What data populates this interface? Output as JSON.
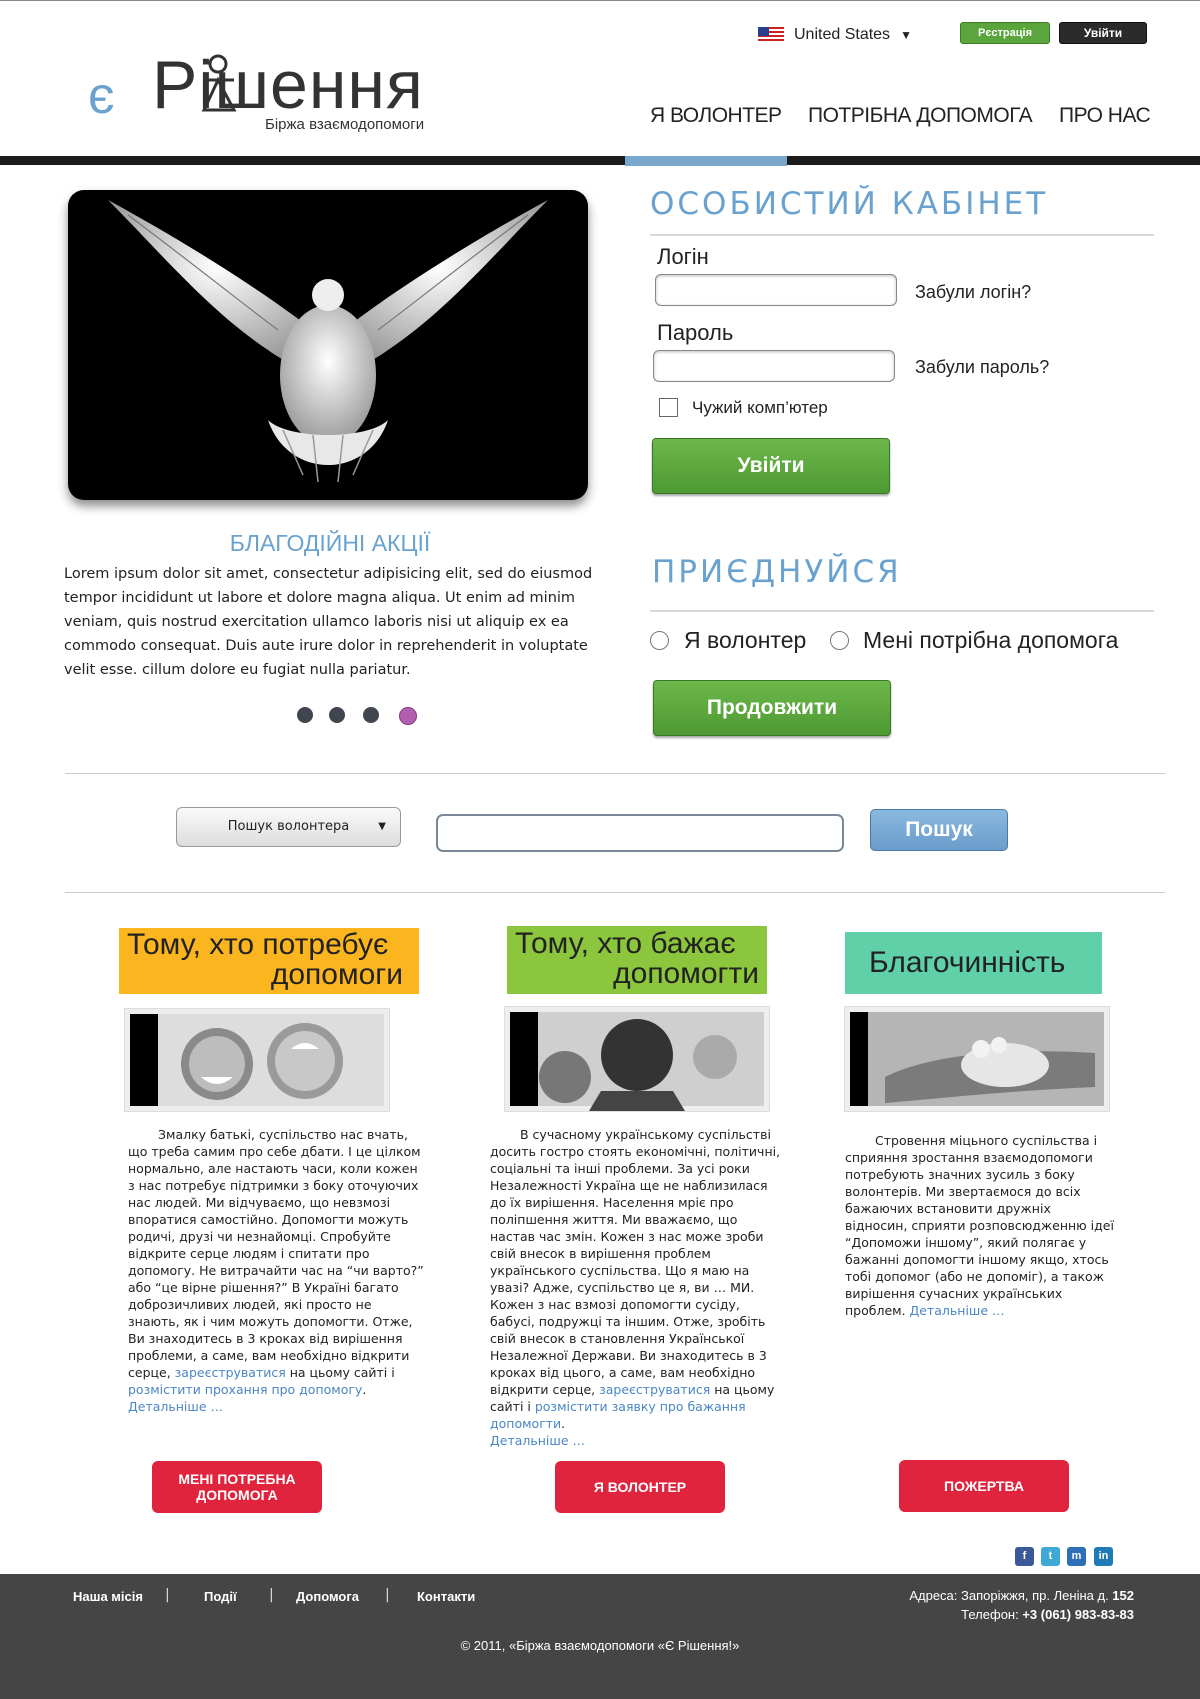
{
  "header": {
    "logo_e": "є",
    "logo_main": "Рішення",
    "logo_sub": "Біржа взаємодопомоги",
    "locale": "United States",
    "register": "Рєстрація",
    "login": "Увійти",
    "nav": [
      "Я ВОЛОНТЕР",
      "ПОТРІБНА ДОПОМОГА",
      "ПРО НАС"
    ],
    "active_nav": 0
  },
  "carousel": {
    "title": "БЛАГОДІЙНІ АКЦІЇ",
    "text": "Lorem ipsum dolor sit amet, consectetur adipisicing elit, sed do eiusmod tempor incididunt ut labore et dolore magna aliqua. Ut enim ad minim veniam, quis nostrud exercitation ullamco laboris nisi ut aliquip ex ea commodo consequat. Duis aute irure dolor in reprehenderit in voluptate velit esse.  cillum dolore eu fugiat nulla pariatur.",
    "dots": 4,
    "active_dot": 3
  },
  "cabinet": {
    "title": "ОСОБИСТИЙ КАБІНЕТ",
    "login_label": "Логін",
    "forgot_login": "Забули логін?",
    "password_label": "Пароль",
    "forgot_password": "Забули пароль?",
    "foreign_pc": "Чужий комп’ютер",
    "submit": "Увійти"
  },
  "join": {
    "title": "ПРИЄДНУЙСЯ",
    "option_volunteer": "Я волонтер",
    "option_help": "Мені потрібна допомога",
    "continue": "Продовжити"
  },
  "search": {
    "select": "Пошук волонтера",
    "button": "Пошук"
  },
  "columns": [
    {
      "heading_1": "Тому, хто потребує",
      "heading_2": "допомоги",
      "color": "#fbb51f",
      "text": "Змалку батькі, суспільство нас вчать, що треба самим про себе дбати. І це цілком нормально, але настають часи, коли кожен з нас потребує підтримки з боку оточуючих нас людей. Ми відчуваємо, що невзмозі впоратися самостійно. Допомогти можуть родичі, друзі чи незнайомці. Спробуйте відкрите серце людям і спитати про допомогу. Не витрачайти час на “чи варто?” або “це вірне рішення?” В Україні багато доброзичливих людей, які просто не знають, як і чим можуть допомогти. Отже, Ви знаходитесь в 3 кроках від вирішення проблеми, а саме, вам необхідно відкрити серце, ",
      "link1": "зареєструватися",
      "mid": " на цьому сайті і ",
      "link2": "розмістити прохання про допомогу",
      "end": ".",
      "more": "Детальніше …",
      "button": "МЕНІ ПОТРЕБНА ДОПОМОГА"
    },
    {
      "heading_1": "Тому, хто  бажає",
      "heading_2": "допомогти",
      "color": "#8bc63d",
      "text": "В сучасному українському суспільстві досить гостро стоять економічні, політичні, соціальні та інші проблеми. За усі роки Незалежності Україна ще не наблизилася до їх вирішення. Населення мріє про поліпшення життя. Ми вважаємо, що настав час змін. Кожен з нас може зроби свій внесок в вирішення проблем українського суспільства. Що я маю на увазі? Адже, суспільство це я, ви … МИ. Кожен з нас взмозі допомогти сусіду, бабусі, подружці та іншим. Отже, зробіть свій внесок в становлення Української Незалежної Держави. Ви знаходитесь в 3 кроках від цього, а саме, вам необхідно відкрити серце, ",
      "link1": "зареєструватися",
      "mid": " на цьому сайті і ",
      "link2": "розмістити заявку про бажання допомогти",
      "end": ".",
      "more": "Детальніше …",
      "button": "Я ВОЛОНТЕР"
    },
    {
      "heading_1": "Благочинність",
      "heading_2": "",
      "color": "#5fd0a8",
      "text": "Стровення міцьного суспільства і сприяння зростання взаємодопомоги потребують значних зусиль з боку волонтерів. Ми звертаємося до всіх бажаючих встановити дружніх відносин, сприяти розповсюдженню ідеї “Допоможи іншому”, який полягає у бажанні допомогти іншому якщо, хтось тобі допомог (або не допоміг), а також вирішення сучасних українських проблем. ",
      "more": "Детальніше …",
      "button": "ПОЖЕРТВА"
    }
  ],
  "social": [
    "f",
    "t",
    "m",
    "in"
  ],
  "footer": {
    "links": [
      "Наша місія",
      "Події",
      "Допомога",
      "Контакти"
    ],
    "address_label": "Адреса: Запоріжжя, пр. Леніна д. ",
    "address_num": "152",
    "phone_label": "Телефон: ",
    "phone": "+3 (061) 983-83-83",
    "copyright": "© 2011, «Біржа взаємодопомоги «Є Рішення!»"
  }
}
